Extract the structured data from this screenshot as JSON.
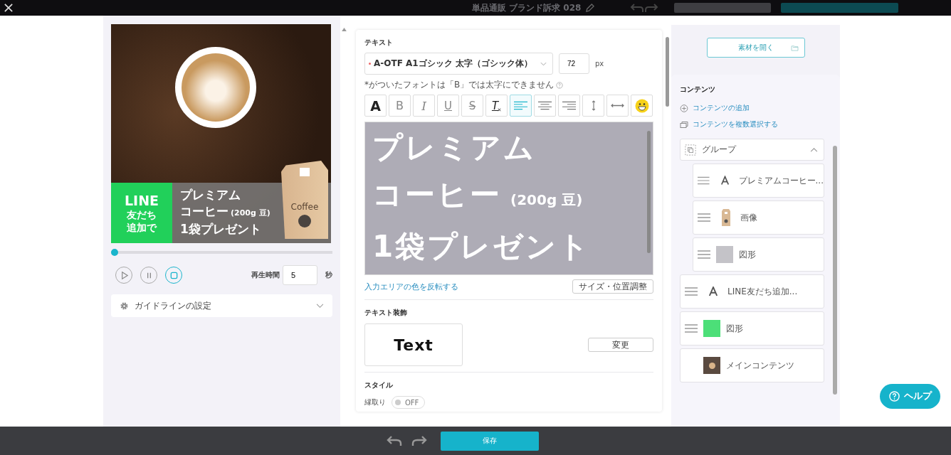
{
  "top_bar": {
    "title": "単品通販 ブランド訴求 028"
  },
  "preview": {
    "banner_badge": [
      "LINE",
      "友だち",
      "追加で"
    ],
    "banner_lines": [
      {
        "text": "プレミアム"
      },
      {
        "text": "コーヒー",
        "note": "(200g 豆)"
      },
      {
        "text": "1袋プレゼント"
      }
    ],
    "bag_label": "Coffee"
  },
  "player": {
    "progress": {
      "level": 0
    },
    "controls": [
      {
        "kind": "play",
        "selected": false
      },
      {
        "kind": "pause",
        "selected": false
      },
      {
        "kind": "stop",
        "selected": true
      }
    ],
    "duration_label": "再生時間",
    "duration": "5",
    "duration_unit": "秒"
  },
  "guideline": {
    "label": "ガイドラインの設定",
    "expanded": false
  },
  "text_section": {
    "title": "テキスト",
    "font": "A-OTF A1ゴシック 太字（ゴシック体）",
    "font_marked": true,
    "size": "72",
    "size_unit": "px",
    "note": "*がついたフォントは「B」では太字にできません",
    "tools": [
      {
        "kind": "color",
        "label": "A",
        "selected": false
      },
      {
        "kind": "bold",
        "label": "B",
        "selected": false
      },
      {
        "kind": "italic",
        "label": "I",
        "selected": false
      },
      {
        "kind": "underline",
        "label": "U",
        "selected": false
      },
      {
        "kind": "strike",
        "label": "S",
        "selected": false
      },
      {
        "kind": "clear",
        "label": "T",
        "selected": false
      },
      {
        "kind": "align-left",
        "selected": true
      },
      {
        "kind": "align-center",
        "selected": false
      },
      {
        "kind": "align-right",
        "selected": false
      },
      {
        "kind": "line-height",
        "selected": false
      },
      {
        "kind": "letter-spacing",
        "selected": false
      },
      {
        "kind": "emoji",
        "selected": false
      }
    ],
    "lines": [
      {
        "text": "プレミアム"
      },
      {
        "text": "コーヒー",
        "note": "(200g 豆)"
      },
      {
        "text": "1袋プレゼント"
      }
    ],
    "invert_link": "入力エリアの色を反転する",
    "size_button": "サイズ・位置調整"
  },
  "decoration": {
    "title": "テキスト装飾",
    "sample": "Text",
    "change_button": "変更"
  },
  "style": {
    "title": "スタイル",
    "outline_label": "縁取り",
    "outline_on": false,
    "toggle_text": "OFF"
  },
  "materials_button": "素材を開く",
  "contents": {
    "title": "コンテンツ",
    "add_link": "コンテンツの追加",
    "multi_link": "コンテンツを複数選択する",
    "items": [
      {
        "kind": "group",
        "label": "グループ",
        "expanded": true,
        "children": [
          {
            "kind": "text",
            "label": "プレミアムコーヒー..."
          },
          {
            "kind": "image",
            "label": "画像"
          },
          {
            "kind": "shape",
            "label": "図形",
            "color": "#c4c3c8"
          }
        ]
      },
      {
        "kind": "text",
        "label": "LINE友だち追加..."
      },
      {
        "kind": "shape",
        "label": "図形",
        "color": "#4cdf78"
      },
      {
        "kind": "main",
        "label": "メインコンテンツ"
      }
    ]
  },
  "help_button": "ヘルプ",
  "bottom_bar": {
    "save_button": "保存"
  }
}
